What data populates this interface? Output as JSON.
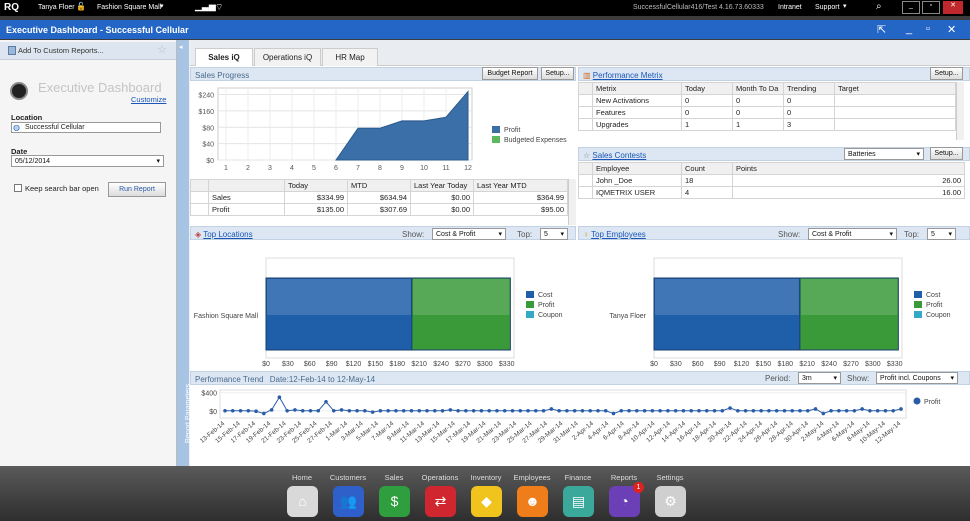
{
  "topbar": {
    "logo": "RQ",
    "user": "Tanya Floer",
    "store": "Fashion Square Mall",
    "server": "SuccessfulCellular416/Test 4.16.73.60333",
    "intranet": "Intranet",
    "support": "Support"
  },
  "window": {
    "title": "Executive Dashboard - Successful Cellular"
  },
  "sidebar": {
    "add_custom": "Add To Custom Reports...",
    "heading": "Executive Dashboard",
    "customize": "Customize",
    "location_label": "Location",
    "location_value": "Successful Cellular",
    "date_label": "Date",
    "date_value": "05/12/2014",
    "keep_open": "Keep search bar open",
    "run_report": "Run Report",
    "report_parameters": "Report Parameters"
  },
  "tabs": [
    "Sales iQ",
    "Operations iQ",
    "HR Map"
  ],
  "sales_progress": {
    "title": "Sales Progress",
    "budget_btn": "Budget Report",
    "setup_btn": "Setup..."
  },
  "sales_table": {
    "headers": [
      "",
      "Today",
      "MTD",
      "Last Year Today",
      "Last Year MTD"
    ],
    "rows": [
      [
        "Sales",
        "$334.99",
        "$634.94",
        "$0.00",
        "$364.99"
      ],
      [
        "Profit",
        "$135.00",
        "$307.69",
        "$0.00",
        "$95.00"
      ]
    ]
  },
  "performance_metrix": {
    "title": "Performance Metrix",
    "setup_btn": "Setup...",
    "headers": [
      "Metrix",
      "Today",
      "Month To Da",
      "Trending",
      "Target"
    ],
    "rows": [
      [
        "New Activations",
        "0",
        "0",
        "0",
        ""
      ],
      [
        "Features",
        "0",
        "0",
        "0",
        ""
      ],
      [
        "Upgrades",
        "1",
        "1",
        "3",
        ""
      ]
    ]
  },
  "sales_contests": {
    "title": "Sales Contests",
    "select": "Batteries",
    "setup_btn": "Setup...",
    "headers": [
      "Employee",
      "Count",
      "Points"
    ],
    "rows": [
      [
        "John _Doe",
        "18",
        "26.00"
      ],
      [
        "IQMETRIX USER",
        "4",
        "16.00"
      ]
    ]
  },
  "top_locations": {
    "title": "Top Locations",
    "show_label": "Show:",
    "show_value": "Cost & Profit",
    "top_label": "Top:",
    "top_value": "5",
    "category": "Fashion Square Mall"
  },
  "top_employees": {
    "title": "Top Employees",
    "show_label": "Show:",
    "show_value": "Cost & Profit",
    "top_label": "Top:",
    "top_value": "5",
    "category": "Tanya Floer"
  },
  "performance_trend": {
    "title": "Performance Trend",
    "range": "Date:12-Feb-14 to 12-May-14",
    "period_label": "Period:",
    "period_value": "3m",
    "show_label": "Show:",
    "show_value": "Profit incl. Coupons"
  },
  "dock": [
    {
      "label": "Home",
      "color": "#d9d9d9",
      "glyph": "⌂"
    },
    {
      "label": "Customers",
      "color": "#2f5fc9",
      "glyph": "👥"
    },
    {
      "label": "Sales",
      "color": "#2e9e3e",
      "glyph": "$"
    },
    {
      "label": "Operations",
      "color": "#d0262f",
      "glyph": "⇄"
    },
    {
      "label": "Inventory",
      "color": "#f1c31d",
      "glyph": "◆"
    },
    {
      "label": "Employees",
      "color": "#ef7d1a",
      "glyph": "☻"
    },
    {
      "label": "Finance",
      "color": "#3aa99b",
      "glyph": "▤"
    },
    {
      "label": "Reports",
      "color": "#6b3fb5",
      "glyph": "◔",
      "badge": "1"
    },
    {
      "label": "Settings",
      "color": "#cfcfcf",
      "glyph": "⚙"
    }
  ],
  "chart_data": [
    {
      "type": "area",
      "title": "Sales Progress",
      "x": [
        1,
        2,
        3,
        4,
        5,
        6,
        7,
        8,
        9,
        10,
        11,
        12
      ],
      "series": [
        {
          "name": "Profit",
          "values": [
            null,
            null,
            null,
            null,
            null,
            0,
            130,
            130,
            160,
            160,
            175,
            280
          ],
          "color": "#3a6fa8"
        },
        {
          "name": "Budgeted Expenses",
          "values": [],
          "color": "#5cb85c"
        }
      ],
      "yticks": [
        "$0",
        "$40",
        "$80",
        "$160",
        "$240"
      ],
      "ylim": [
        0,
        280
      ]
    },
    {
      "type": "bar",
      "title": "Top Locations",
      "orientation": "horizontal",
      "categories": [
        "Fashion Square Mall"
      ],
      "series": [
        {
          "name": "Cost",
          "values": [
            200
          ],
          "color": "#1f5ea8"
        },
        {
          "name": "Profit",
          "values": [
            135
          ],
          "color": "#3a9a3a"
        },
        {
          "name": "Coupon",
          "values": [
            0
          ],
          "color": "#34a9c6"
        }
      ],
      "xticks": [
        "$0",
        "$30",
        "$60",
        "$90",
        "$120",
        "$150",
        "$180",
        "$210",
        "$240",
        "$270",
        "$300",
        "$330"
      ],
      "xlim": [
        0,
        340
      ]
    },
    {
      "type": "bar",
      "title": "Top Employees",
      "orientation": "horizontal",
      "categories": [
        "Tanya Floer"
      ],
      "series": [
        {
          "name": "Cost",
          "values": [
            200
          ],
          "color": "#1f5ea8"
        },
        {
          "name": "Profit",
          "values": [
            135
          ],
          "color": "#3a9a3a"
        },
        {
          "name": "Coupon",
          "values": [
            0
          ],
          "color": "#34a9c6"
        }
      ],
      "xticks": [
        "$0",
        "$30",
        "$60",
        "$90",
        "$120",
        "$150",
        "$180",
        "$210",
        "$240",
        "$270",
        "$300",
        "$330"
      ],
      "xlim": [
        0,
        340
      ]
    },
    {
      "type": "line",
      "title": "Performance Trend",
      "series": [
        {
          "name": "Profit",
          "color": "#2a5da8"
        }
      ],
      "yticks": [
        "$400",
        "$0"
      ],
      "ylim": [
        -160,
        460
      ],
      "x": [
        "13-Feb-14",
        "15-Feb-14",
        "17-Feb-14",
        "19-Feb-14",
        "21-Feb-14",
        "23-Feb-14",
        "25-Feb-14",
        "27-Feb-14",
        "1-Mar-14",
        "3-Mar-14",
        "5-Mar-14",
        "7-Mar-14",
        "9-Mar-14",
        "11-Mar-14",
        "13-Mar-14",
        "15-Mar-14",
        "17-Mar-14",
        "19-Mar-14",
        "21-Mar-14",
        "23-Mar-14",
        "25-Mar-14",
        "27-Mar-14",
        "29-Mar-14",
        "31-Mar-14",
        "2-Apr-14",
        "4-Apr-14",
        "6-Apr-14",
        "8-Apr-14",
        "10-Apr-14",
        "12-Apr-14",
        "14-Apr-14",
        "16-Apr-14",
        "18-Apr-14",
        "20-Apr-14",
        "22-Apr-14",
        "24-Apr-14",
        "26-Apr-14",
        "28-Apr-14",
        "30-Apr-14",
        "2-May-14",
        "4-May-14",
        "6-May-14",
        "8-May-14",
        "10-May-14",
        "12-May-14"
      ],
      "values": [
        0,
        0,
        0,
        0,
        -10,
        -60,
        20,
        300,
        0,
        20,
        0,
        0,
        0,
        200,
        0,
        20,
        0,
        0,
        0,
        -30,
        0,
        0,
        0,
        0,
        0,
        0,
        0,
        0,
        0,
        20,
        0,
        0,
        0,
        0,
        0,
        0,
        0,
        0,
        0,
        0,
        0,
        0,
        40,
        0,
        0,
        0,
        0,
        0,
        0,
        0,
        -60,
        0,
        0,
        0,
        0,
        0,
        0,
        0,
        0,
        0,
        0,
        0,
        0,
        0,
        0,
        60,
        0,
        0,
        0,
        0,
        0,
        0,
        0,
        0,
        0,
        0,
        40,
        -60,
        0,
        0,
        0,
        0,
        40,
        0,
        0,
        0,
        0,
        40
      ]
    }
  ]
}
